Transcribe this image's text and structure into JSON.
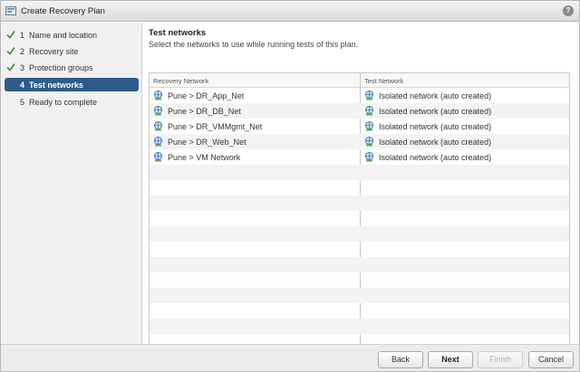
{
  "window": {
    "title": "Create Recovery Plan",
    "help": "?"
  },
  "steps": [
    {
      "num": "1",
      "label": "Name and location",
      "done": true,
      "active": false
    },
    {
      "num": "2",
      "label": "Recovery site",
      "done": true,
      "active": false
    },
    {
      "num": "3",
      "label": "Protection groups",
      "done": true,
      "active": false
    },
    {
      "num": "4",
      "label": "Test networks",
      "done": false,
      "active": true
    },
    {
      "num": "5",
      "label": "Ready to complete",
      "done": false,
      "active": false
    }
  ],
  "page": {
    "heading": "Test networks",
    "subheading": "Select the networks to use while running tests of this plan."
  },
  "grid": {
    "columns": [
      "Recovery Network",
      "Test Network"
    ],
    "rows": [
      {
        "recovery": "Pune > DR_App_Net",
        "test": "Isolated network (auto created)"
      },
      {
        "recovery": "Pune > DR_DB_Net",
        "test": "Isolated network (auto created)"
      },
      {
        "recovery": "Pune > DR_VMMgmt_Net",
        "test": "Isolated network (auto created)"
      },
      {
        "recovery": "Pune > DR_Web_Net",
        "test": "Isolated network (auto created)"
      },
      {
        "recovery": "Pune > VM Network",
        "test": "Isolated network (auto created)"
      }
    ],
    "empty_rows": 13
  },
  "buttons": {
    "back": "Back",
    "next": "Next",
    "finish": "Finish",
    "cancel": "Cancel"
  },
  "colors": {
    "active_step": "#2e5b8a",
    "check": "#3f9a2f",
    "network_icon": "#3a78b8"
  },
  "icons": {
    "window": "recovery-plan-icon",
    "done": "checkmark-icon",
    "network": "network-icon",
    "help": "help-icon"
  }
}
